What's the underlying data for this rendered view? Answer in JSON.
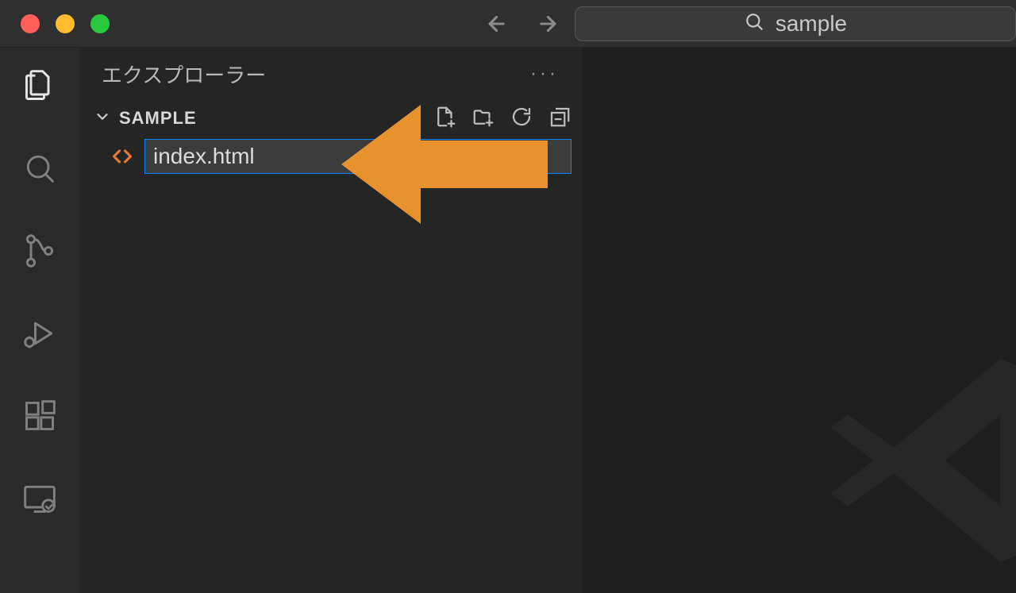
{
  "titlebar": {
    "search_text": "sample"
  },
  "sidebar": {
    "title": "エクスプローラー",
    "folder_name": "SAMPLE",
    "more_label": "···"
  },
  "file": {
    "value": "index.html"
  },
  "colors": {
    "arrow": "#e8912f",
    "focus_border": "#0a84ff",
    "html_icon": "#e37933"
  }
}
